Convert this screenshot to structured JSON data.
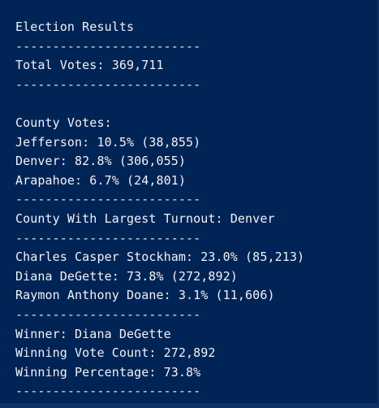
{
  "terminal": {
    "lines": {
      "l01": "Election Results",
      "l02": "-------------------------",
      "l03": "Total Votes: 369,711",
      "l04": "-------------------------",
      "l05": "",
      "l06": "County Votes:",
      "l07": "Jefferson: 10.5% (38,855)",
      "l08": "Denver: 82.8% (306,055)",
      "l09": "Arapahoe: 6.7% (24,801)",
      "l10": "-------------------------",
      "l11": "County With Largest Turnout: Denver",
      "l12": "-------------------------",
      "l13": "Charles Casper Stockham: 23.0% (85,213)",
      "l14": "Diana DeGette: 73.8% (272,892)",
      "l15": "Raymon Anthony Doane: 3.1% (11,606)",
      "l16": "-------------------------",
      "l17": "Winner: Diana DeGette",
      "l18": "Winning Vote Count: 272,892",
      "l19": "Winning Percentage: 73.8%",
      "l20": "-------------------------"
    }
  },
  "colors": {
    "background": "#012456",
    "text": "#f2f2f2"
  }
}
